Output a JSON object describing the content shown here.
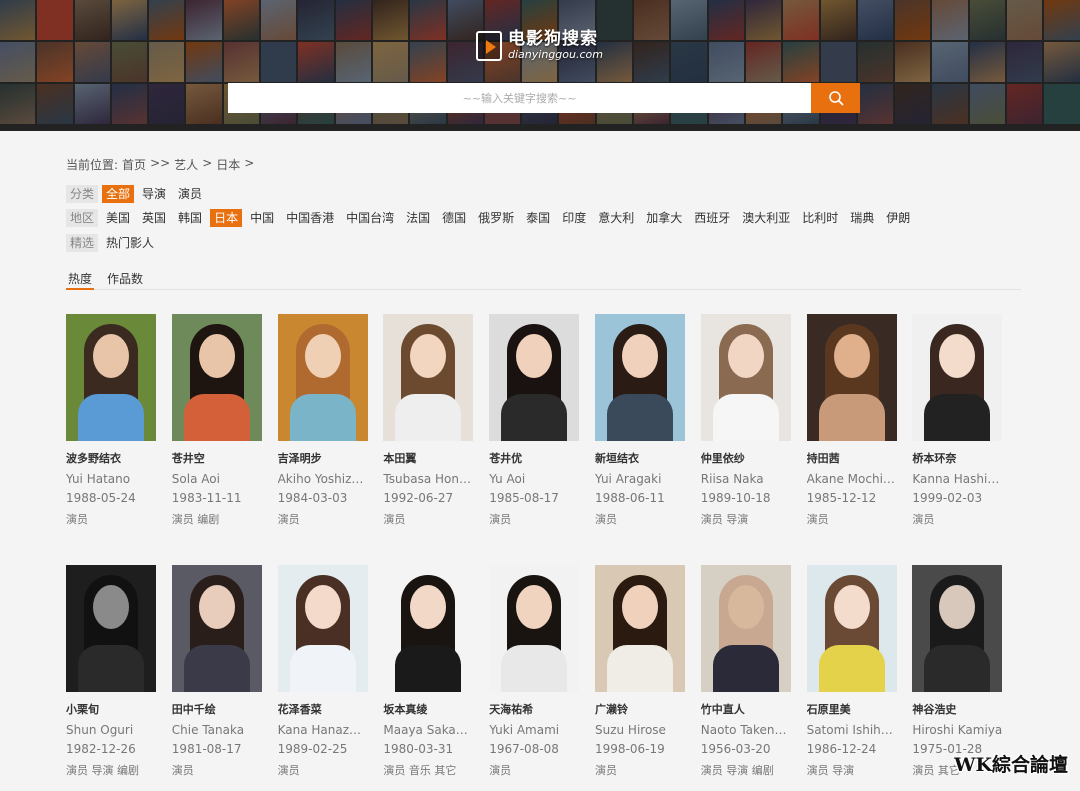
{
  "header": {
    "logo_title": "电影狗搜索",
    "logo_domain": "dianyinggou.com",
    "search_placeholder": "~~输入关键字搜索~~",
    "poster_colors": [
      "#3b4a5c",
      "#7a2f2a",
      "#5a5e44",
      "#2c3a4f",
      "#8a6a3a",
      "#4a2d3b",
      "#6b7b8c",
      "#9b3b2b",
      "#2f4f4f",
      "#7c6f5a",
      "#3d2c24",
      "#54607a",
      "#a0522d",
      "#2b3a55",
      "#6e5b4a",
      "#40485c",
      "#8b4513",
      "#334455",
      "#5c4033",
      "#707a8a",
      "#3a2f4a",
      "#9a7b4f",
      "#2e3b3b",
      "#6a3d3d",
      "#4f5d75",
      "#7d5a44",
      "#2d2d40",
      "#8f6d4a",
      "#3f5060",
      "#5b3a29"
    ]
  },
  "breadcrumb": {
    "label": "当前位置:",
    "home": "首页",
    "sep1": ">>",
    "section": "艺人",
    "sep2": ">",
    "region": "日本",
    "sep3": ">"
  },
  "filters": {
    "category": {
      "label": "分类",
      "items": [
        "全部",
        "导演",
        "演员"
      ],
      "active": 0
    },
    "region": {
      "label": "地区",
      "items": [
        "美国",
        "英国",
        "韩国",
        "日本",
        "中国",
        "中国香港",
        "中国台湾",
        "法国",
        "德国",
        "俄罗斯",
        "泰国",
        "印度",
        "意大利",
        "加拿大",
        "西班牙",
        "澳大利亚",
        "比利时",
        "瑞典",
        "伊朗"
      ],
      "active": 3
    },
    "featured": {
      "label": "精选",
      "items": [
        "热门影人"
      ]
    }
  },
  "tabs": [
    {
      "label": "热度",
      "active": true
    },
    {
      "label": "作品数",
      "active": false
    }
  ],
  "artists": [
    {
      "name": "波多野结衣",
      "roman": "Yui Hatano",
      "date": "1988-05-24",
      "roles": "演员",
      "bg": "#6a8a3a",
      "hair": "#3a2a20",
      "skin": "#e8c4a8",
      "cloth": "#5a9bd5"
    },
    {
      "name": "苍井空",
      "roman": "Sola Aoi",
      "date": "1983-11-11",
      "roles": "演员 编剧",
      "bg": "#6f8a5a",
      "hair": "#1e1510",
      "skin": "#e8c4a8",
      "cloth": "#d4603a"
    },
    {
      "name": "吉泽明步",
      "roman": "Akiho Yoshizawa",
      "date": "1984-03-03",
      "roles": "演员",
      "bg": "#c9882f",
      "hair": "#b06a30",
      "skin": "#f0d0b4",
      "cloth": "#7ab4c8"
    },
    {
      "name": "本田翼",
      "roman": "Tsubasa Honda",
      "date": "1992-06-27",
      "roles": "演员",
      "bg": "#e6e0d8",
      "hair": "#6b4a30",
      "skin": "#f2d6c0",
      "cloth": "#eeeeee"
    },
    {
      "name": "苍井优",
      "roman": "Yu Aoi",
      "date": "1985-08-17",
      "roles": "演员",
      "bg": "#dcdcdc",
      "hair": "#1a1210",
      "skin": "#f0d2bc",
      "cloth": "#2a2a2a"
    },
    {
      "name": "新垣结衣",
      "roman": "Yui Aragaki",
      "date": "1988-06-11",
      "roles": "演员",
      "bg": "#9cc4d8",
      "hair": "#2a1c14",
      "skin": "#f0d2bc",
      "cloth": "#3a4a5a"
    },
    {
      "name": "仲里依纱",
      "roman": "Riisa Naka",
      "date": "1989-10-18",
      "roles": "演员 导演",
      "bg": "#e8e4e0",
      "hair": "#8a6a50",
      "skin": "#f2d6c4",
      "cloth": "#f6f6f6"
    },
    {
      "name": "持田茜",
      "roman": "Akane Mochida",
      "date": "1985-12-12",
      "roles": "演员",
      "bg": "#3a2a24",
      "hair": "#5a3820",
      "skin": "#e0b08c",
      "cloth": "#c89a7a"
    },
    {
      "name": "桥本环奈",
      "roman": "Kanna Hashim...",
      "date": "1999-02-03",
      "roles": "演员",
      "bg": "#f0f0f0",
      "hair": "#3a2820",
      "skin": "#f4dccc",
      "cloth": "#222222"
    },
    {
      "name": "小栗旬",
      "roman": "Shun Oguri",
      "date": "1982-12-26",
      "roles": "演员 导演 编剧",
      "bg": "#1e1e1e",
      "hair": "#111111",
      "skin": "#8a8a8a",
      "cloth": "#2a2a2a"
    },
    {
      "name": "田中千绘",
      "roman": "Chie Tanaka",
      "date": "1981-08-17",
      "roles": "演员",
      "bg": "#5a5a64",
      "hair": "#2a1e1a",
      "skin": "#e8cdbc",
      "cloth": "#3a3a48"
    },
    {
      "name": "花泽香菜",
      "roman": "Kana Hanazawa",
      "date": "1989-02-25",
      "roles": "演员",
      "bg": "#e4ecf0",
      "hair": "#4a3024",
      "skin": "#f4dacb",
      "cloth": "#f0f4f8"
    },
    {
      "name": "坂本真绫",
      "roman": "Maaya Sakam...",
      "date": "1980-03-31",
      "roles": "演员 音乐 其它",
      "bg": "#f4f4f4",
      "hair": "#1a1410",
      "skin": "#f2d8c6",
      "cloth": "#1a1a1a"
    },
    {
      "name": "天海祐希",
      "roman": "Yuki Amami",
      "date": "1967-08-08",
      "roles": "演员",
      "bg": "#f2f2f2",
      "hair": "#1a1410",
      "skin": "#f0d4c0",
      "cloth": "#e8e8e8"
    },
    {
      "name": "广濑铃",
      "roman": "Suzu Hirose",
      "date": "1998-06-19",
      "roles": "演员",
      "bg": "#d8c8b4",
      "hair": "#2a1a10",
      "skin": "#f0d2bc",
      "cloth": "#f0ede6"
    },
    {
      "name": "竹中直人",
      "roman": "Naoto Takenaka",
      "date": "1956-03-20",
      "roles": "演员 导演 编剧",
      "bg": "#d6d0c4",
      "hair": "#c8a890",
      "skin": "#d8b89c",
      "cloth": "#2a2a38"
    },
    {
      "name": "石原里美",
      "roman": "Satomi Ishihara",
      "date": "1986-12-24",
      "roles": "演员 导演",
      "bg": "#dce8ec",
      "hair": "#6a4a34",
      "skin": "#f4dccc",
      "cloth": "#e4d24a"
    },
    {
      "name": "神谷浩史",
      "roman": "Hiroshi Kamiya",
      "date": "1975-01-28",
      "roles": "演员 其它",
      "bg": "#4a4a4a",
      "hair": "#1a1a1a",
      "skin": "#d8c8bc",
      "cloth": "#2a2a2a"
    }
  ],
  "watermark": "WK綜合論壇",
  "accent_color": "#e8700e"
}
